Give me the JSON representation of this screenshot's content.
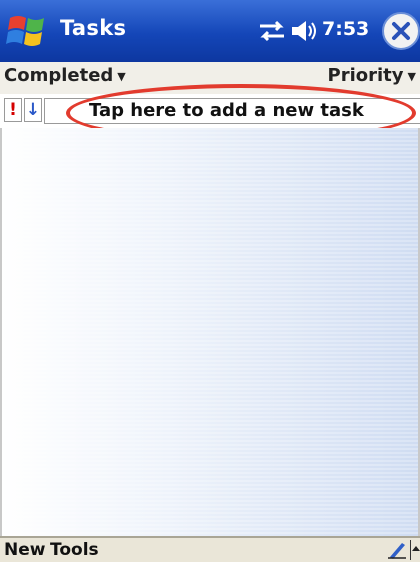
{
  "titlebar": {
    "app_title": "Tasks",
    "clock": "7:53",
    "start_icon": "windows-flag-icon",
    "connectivity_icon": "connectivity-icon",
    "volume_icon": "speaker-icon",
    "close_icon": "close-icon"
  },
  "filterbar": {
    "filter_label": "Completed",
    "sort_label": "Priority"
  },
  "entrybar": {
    "priority_glyph": "!",
    "sort_glyph": "↓",
    "new_task_placeholder": "Tap here to add a new task"
  },
  "menubar": {
    "new_label": "New",
    "tools_label": "Tools"
  },
  "colors": {
    "title_bar": "#1446b8",
    "highlight": "#e23b2e",
    "priority_red": "#d40000"
  }
}
